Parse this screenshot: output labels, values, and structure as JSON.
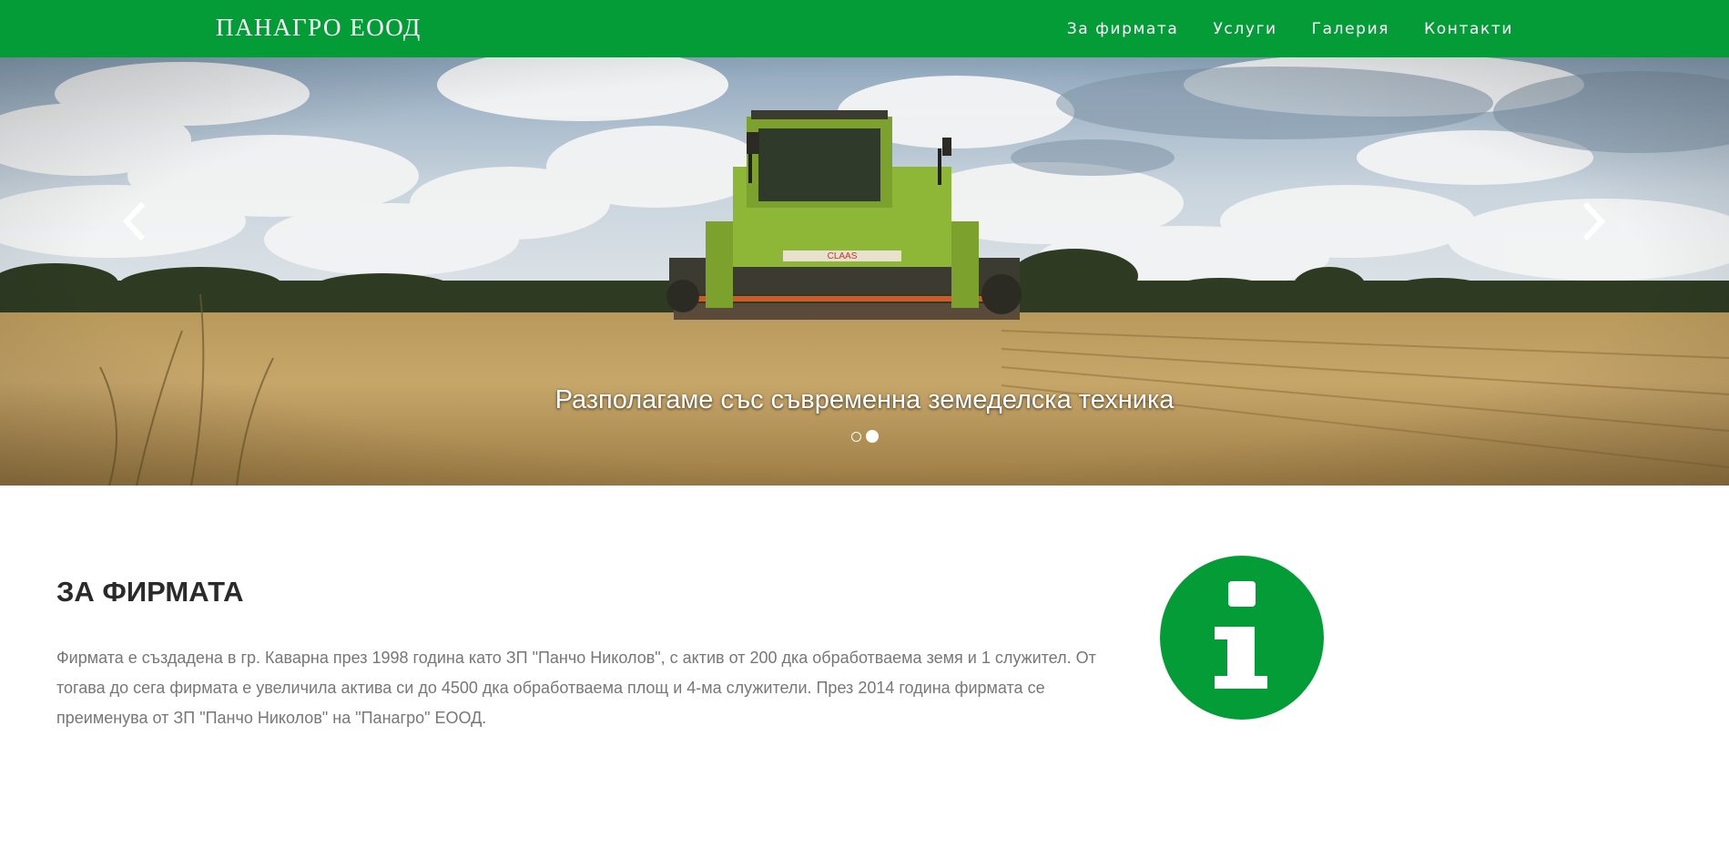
{
  "brand": "ПАНАГРО ЕООД",
  "nav": {
    "items": [
      {
        "label": "За фирмата"
      },
      {
        "label": "Услуги"
      },
      {
        "label": "Галерия"
      },
      {
        "label": "Контакти"
      }
    ]
  },
  "carousel": {
    "caption": "Разполагаме със съвременна земеделска техника",
    "prev_icon": "chevron-left-icon",
    "next_icon": "chevron-right-icon",
    "slide_count": 2,
    "active_slide": 2
  },
  "about": {
    "title": "ЗА ФИРМАТА",
    "text": "Фирмата е създадена в гр. Каварна през 1998 година като ЗП \"Панчо Николов\", с актив от 200 дка обработваема земя и 1 служител. От тогава до сега фирмата е увеличила актива си до 4500 дка обработваема площ и 4-ма служители. През 2014 година фирмата се преименува от ЗП \"Панчо Николов\" на \"Панагро\" ЕООД.",
    "icon": "info-icon"
  },
  "colors": {
    "brand_green": "#049c37",
    "text_dark": "#2a2a2a",
    "text_muted": "#777777"
  }
}
